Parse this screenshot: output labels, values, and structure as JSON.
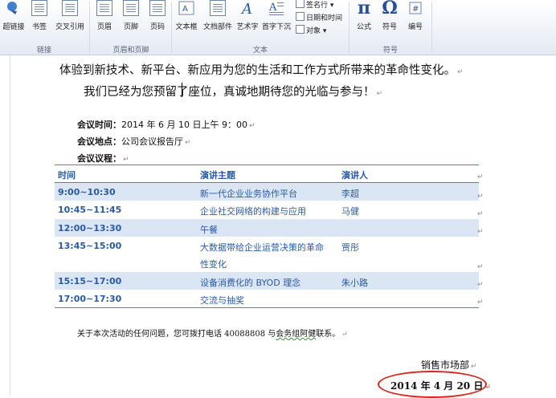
{
  "ribbon": {
    "groups": {
      "links": {
        "label": "链接",
        "buttons": [
          "超链接",
          "书签",
          "交叉引用"
        ]
      },
      "header_footer": {
        "label": "页眉和页脚",
        "buttons": [
          "页眉",
          "页脚",
          "页码"
        ]
      },
      "text": {
        "label": "文本",
        "buttons": [
          "文本框",
          "文档部件",
          "艺术字",
          "首字下沉"
        ],
        "small_items": [
          "签名行 ▾",
          "日期和时间",
          "对象 ▾"
        ]
      },
      "symbols": {
        "label": "符号",
        "buttons": [
          "公式",
          "符号",
          "编号"
        ],
        "glyphs": [
          "π",
          "Ω",
          "#"
        ]
      }
    }
  },
  "document": {
    "intro_line1": "体验到新技术、新平台、新应用为您的生活和工作方式所带来的革命性变化。",
    "intro_line2": "我们已经为您预留了座位，真诚地期待您的光临与参与！",
    "meeting_time_label": "会议时间：",
    "meeting_time_value": "2014 年 6 月 10 日上午 9：00",
    "meeting_place_label": "会议地点：",
    "meeting_place_value": "公司会议报告厅",
    "agenda_label": "会议议程：",
    "paragraph_mark": "↵",
    "table": {
      "headers": [
        "时间",
        "演讲主题",
        "演讲人"
      ],
      "rows": [
        [
          "9:00~10:30",
          "新一代企业业务协作平台",
          "李超"
        ],
        [
          "10:45~11:45",
          "企业社交网络的构建与应用",
          "马健"
        ],
        [
          "12:00~13:30",
          "午餐",
          ""
        ],
        [
          "13:45~15:00",
          "大数据带给企业运营决策的革命",
          "贾彤"
        ],
        [
          "",
          "性变化",
          ""
        ],
        [
          "15:15~17:00",
          "设备消费化的 BYOD 理念",
          "朱小路"
        ],
        [
          "17:00~17:30",
          "交流与抽奖",
          ""
        ]
      ]
    },
    "contact_note_pre": "关于本次活动的任何问题，您可拨打电话 40088808 与",
    "contact_note_name": "会务组阿健",
    "contact_note_post": "联系。",
    "department": "销售市场部",
    "date": "2014 年 4 月 20 日"
  },
  "colors": {
    "accent_blue": "#2b5aa3",
    "row_highlight": "#dae6f4",
    "annotation_red": "#d9261c"
  }
}
